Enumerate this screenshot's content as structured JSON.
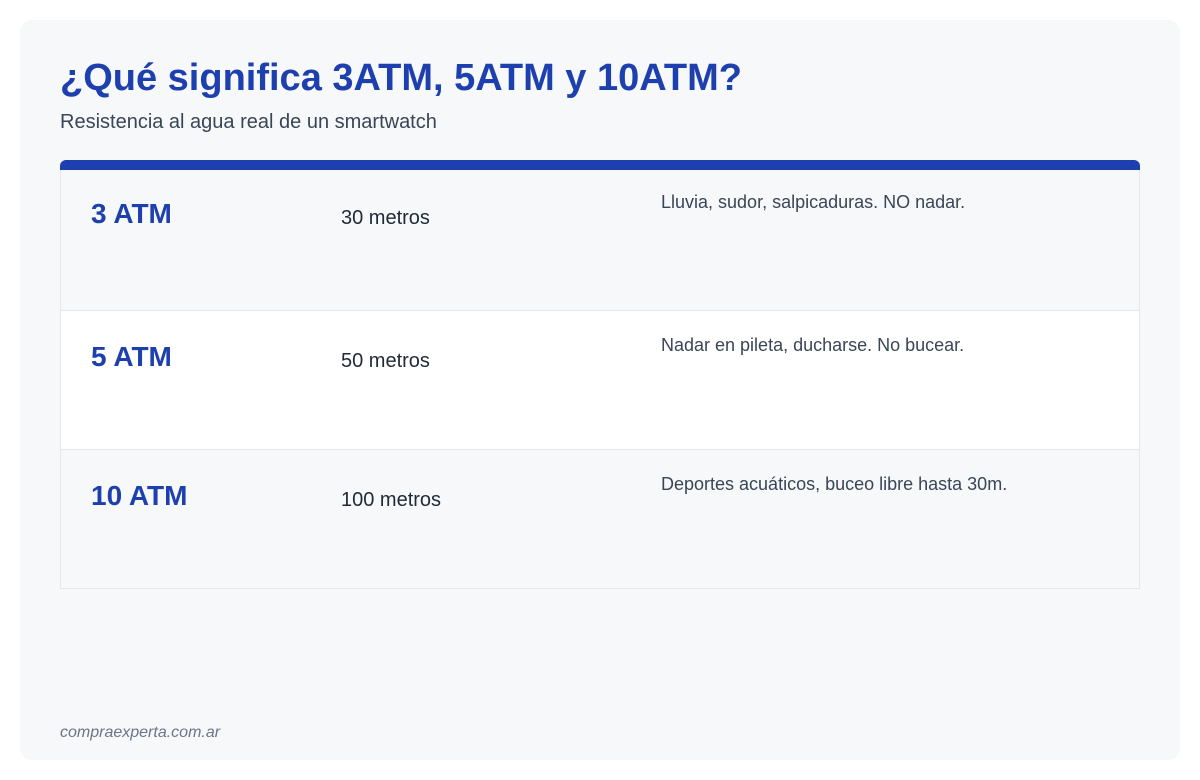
{
  "header": {
    "title": "¿Qué significa 3ATM, 5ATM y 10ATM?",
    "subtitle": "Resistencia al agua real de un smartwatch"
  },
  "table": {
    "rows": [
      {
        "level": "3 ATM",
        "depth": "30 metros",
        "use": "Lluvia, sudor, salpicaduras. NO nadar."
      },
      {
        "level": "5 ATM",
        "depth": "50 metros",
        "use": "Nadar en pileta, ducharse. No bucear."
      },
      {
        "level": "10 ATM",
        "depth": "100 metros",
        "use": "Deportes acuáticos, buceo libre hasta 30m."
      }
    ]
  },
  "footer": {
    "source": "compraexperta.com.ar"
  },
  "colors": {
    "accent": "#1e3fae",
    "card_background": "#f7f8fa",
    "text_primary": "#1f2937",
    "text_secondary": "#3a4556",
    "footer_text": "#6b7588",
    "border": "#e4e7ec"
  }
}
